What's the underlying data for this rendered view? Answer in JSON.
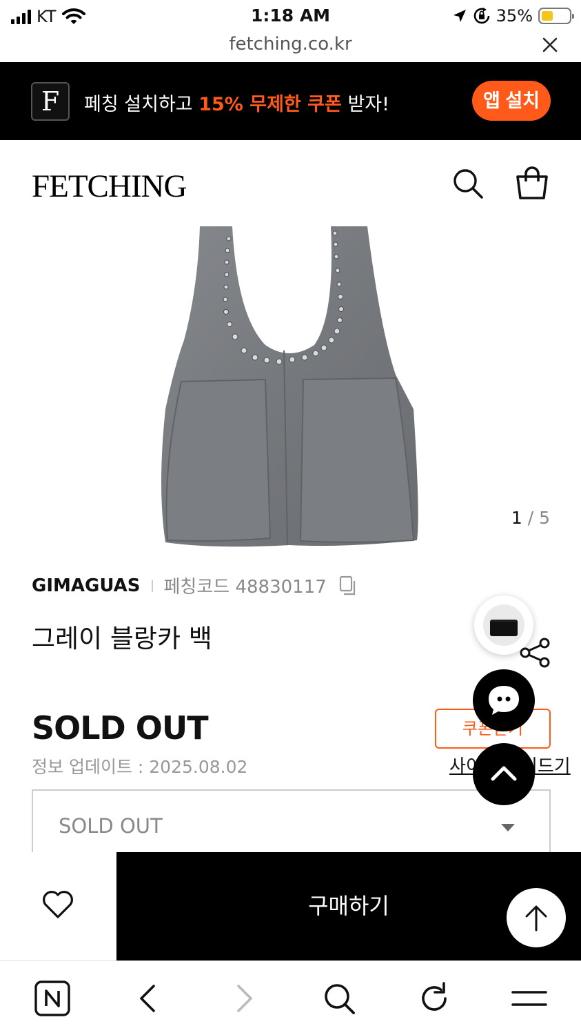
{
  "status_bar": {
    "carrier": "KT",
    "time": "1:18 AM",
    "battery_percent": "35%",
    "battery_level": 0.35,
    "battery_color": "#f5c518"
  },
  "browser": {
    "url": "fetching.co.kr"
  },
  "app_banner": {
    "logo_letter": "F",
    "text_before": "페칭 설치하고 ",
    "text_highlight": "15% 무제한 쿠폰",
    "text_after": " 받자!",
    "install_label": "앱 설치",
    "accent_color": "#ff5a1a"
  },
  "header": {
    "logo": "FETCHING",
    "icons": [
      "search-icon",
      "shopping-bag-icon"
    ]
  },
  "gallery": {
    "current": "1",
    "separator": "/",
    "total": "5"
  },
  "product": {
    "brand": "GIMAGUAS",
    "code_label": "페칭코드 48830117",
    "name": "그레이 블랑카 백",
    "price": "SOLD OUT",
    "update_info": "정보 업데이트 : 2025.08.02"
  },
  "actions": {
    "coupon_label": "쿠폰받기",
    "size_guide_label": "사이즈 가이드기"
  },
  "option": {
    "selected": "SOLD OUT"
  },
  "purchase_bar": {
    "buy_label": "구매하기"
  },
  "toolbar": {
    "icons": [
      "naver-icon",
      "back-icon",
      "forward-icon",
      "search-icon",
      "reload-icon",
      "menu-icon"
    ]
  }
}
